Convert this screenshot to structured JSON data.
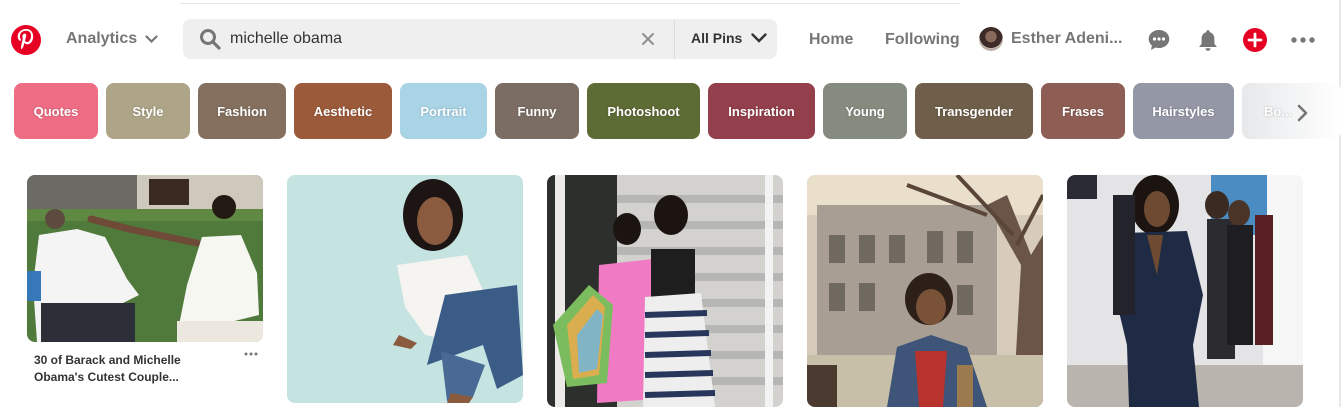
{
  "header": {
    "analytics_label": "Analytics",
    "search": {
      "value": "michelle obama",
      "scope": "All Pins"
    },
    "nav": {
      "home": "Home",
      "following": "Following"
    },
    "user_name": "Esther Adeni...",
    "icons": [
      "pinterest-logo",
      "search-icon",
      "clear-icon",
      "chevron-down-icon",
      "chat-icon",
      "bell-icon",
      "plus-icon",
      "more-icon"
    ]
  },
  "chips": [
    {
      "label": "Quotes",
      "color": "#ef6d84"
    },
    {
      "label": "Style",
      "color": "#aea588"
    },
    {
      "label": "Fashion",
      "color": "#85705f"
    },
    {
      "label": "Aesthetic",
      "color": "#9b5a3a"
    },
    {
      "label": "Portrait",
      "color": "#a8d4e6"
    },
    {
      "label": "Funny",
      "color": "#7b6d63"
    },
    {
      "label": "Photoshoot",
      "color": "#5d6b34"
    },
    {
      "label": "Inspiration",
      "color": "#943f4c"
    },
    {
      "label": "Young",
      "color": "#858c7f"
    },
    {
      "label": "Transgender",
      "color": "#6f5f4a"
    },
    {
      "label": "Frases",
      "color": "#8e5e55"
    },
    {
      "label": "Hairstyles",
      "color": "#9497a6"
    },
    {
      "label": "Bo...",
      "color": "#e6e8ea"
    }
  ],
  "pins": [
    {
      "title": "30 of Barack and Michelle Obama's Cutest Couple...",
      "more": "···"
    }
  ],
  "colors": {
    "brand": "#e60023",
    "nav_text": "#767676",
    "search_bg": "#efefef"
  }
}
